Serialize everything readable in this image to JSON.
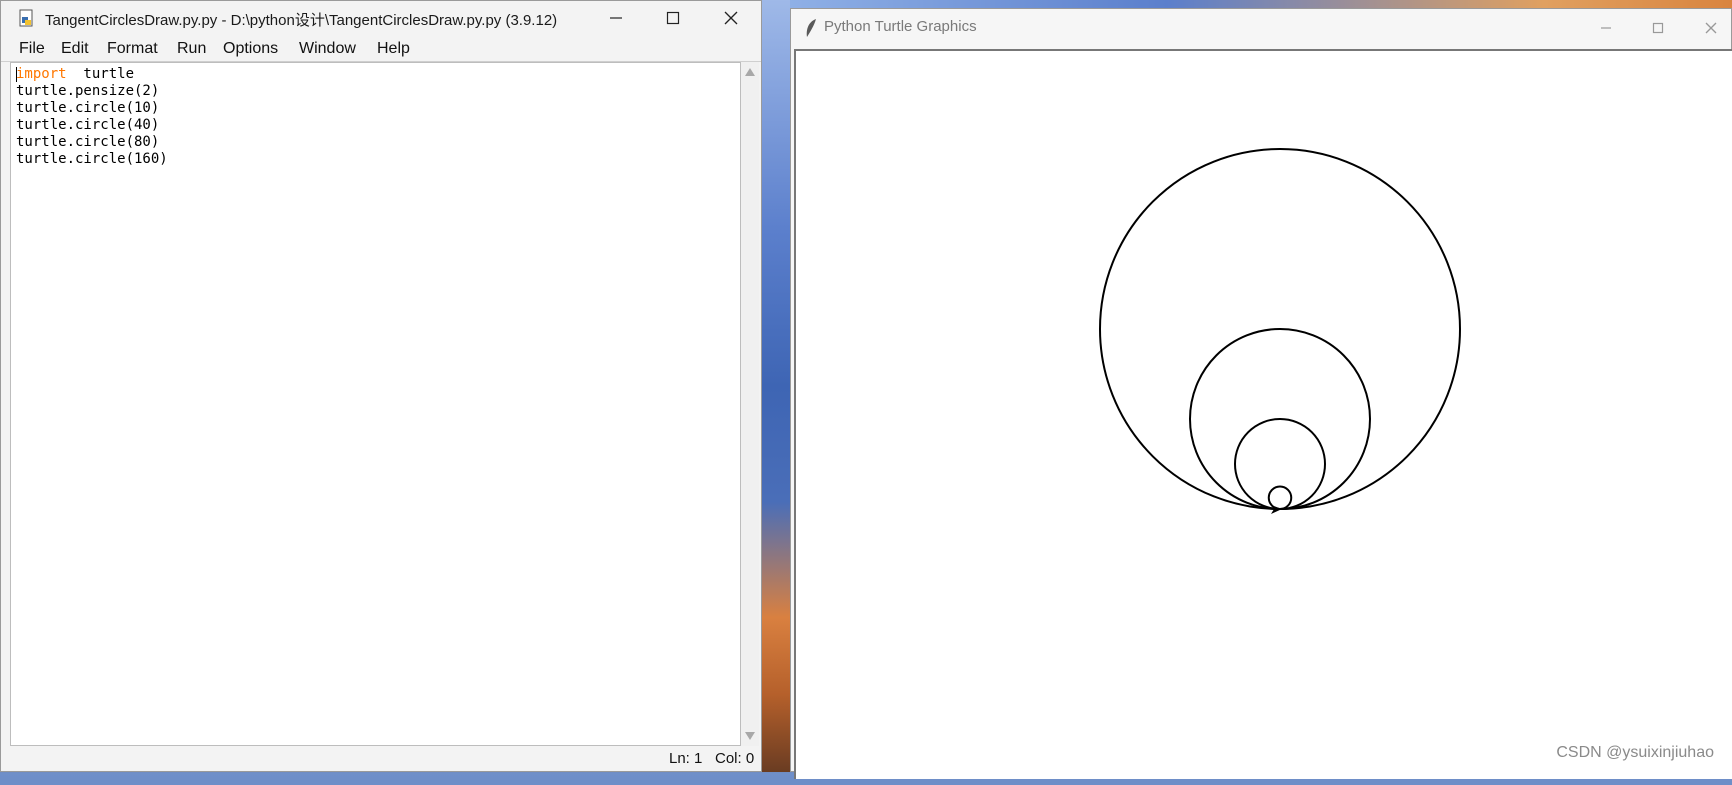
{
  "idle_window": {
    "title": "TangentCirclesDraw.py.py - D:\\python设计\\TangentCirclesDraw.py.py (3.9.12)",
    "menu": [
      "File",
      "Edit",
      "Format",
      "Run",
      "Options",
      "Window",
      "Help"
    ],
    "code": {
      "line1_keyword": "import",
      "line1_rest": "  turtle",
      "lines": [
        "turtle.pensize(2)",
        "turtle.circle(10)",
        "turtle.circle(40)",
        "turtle.circle(80)",
        "turtle.circle(160)"
      ]
    },
    "status": {
      "line": "Ln: 1",
      "col": "Col: 0"
    }
  },
  "turtle_window": {
    "title": "Python Turtle Graphics",
    "pensize": 2,
    "circle_radii": [
      10,
      40,
      80,
      160
    ],
    "pen_color": "#000000"
  },
  "watermark": "CSDN @ysuixinjiuhao",
  "colors": {
    "keyword": "#ff7700",
    "editor_bg": "#ffffff",
    "chrome_bg": "#f3f3f3"
  }
}
